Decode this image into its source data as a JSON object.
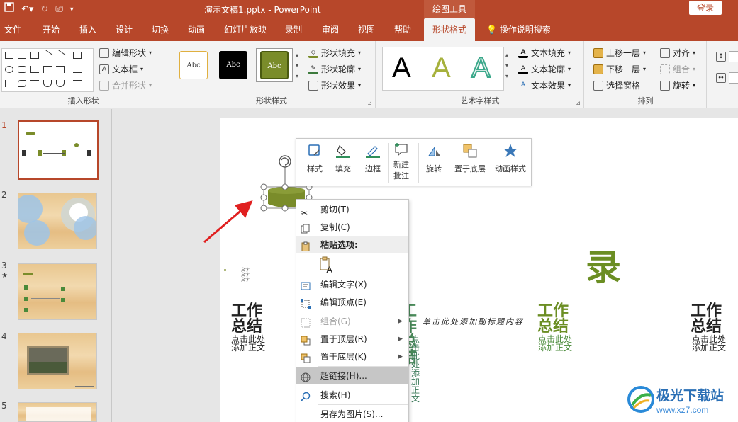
{
  "titlebar": {
    "doc_title": "演示文稿1.pptx  -  PowerPoint",
    "context_tools": "绘图工具",
    "login": "登录"
  },
  "tabs": [
    "文件",
    "开始",
    "插入",
    "设计",
    "切换",
    "动画",
    "幻灯片放映",
    "录制",
    "审阅",
    "视图",
    "帮助",
    "形状格式",
    "操作说明搜索"
  ],
  "ribbon": {
    "insert_shapes": {
      "label": "插入形状",
      "edit_shape": "编辑形状",
      "text_box": "文本框",
      "merge_shapes": "合并形状"
    },
    "shape_styles": {
      "label": "形状样式",
      "swatch_text": "Abc",
      "fill": "形状填充",
      "outline": "形状轮廓",
      "effects": "形状效果"
    },
    "wordart": {
      "label": "艺术字样式",
      "letter": "A",
      "text_fill": "文本填充",
      "text_outline": "文本轮廓",
      "text_effects": "文本效果"
    },
    "arrange": {
      "label": "排列",
      "bring_forward": "上移一层",
      "send_backward": "下移一层",
      "selection_pane": "选择窗格",
      "align": "对齐",
      "group": "组合",
      "rotate": "旋转"
    }
  },
  "thumbnails": [
    "1",
    "2",
    "3",
    "4",
    "5"
  ],
  "slide": {
    "title_block": "工作\n总结",
    "sub_line1": "点击此处",
    "sub_line2": "添加正文",
    "big_char": "录",
    "subtitle_line": "单击此处添加副标题内容"
  },
  "minibar": {
    "style": "样式",
    "fill": "填充",
    "outline": "边框",
    "new_comment_1": "新建",
    "new_comment_2": "批注",
    "rotate": "旋转",
    "send_back": "置于底层",
    "animation": "动画样式"
  },
  "context_menu": {
    "cut": "剪切(T)",
    "copy": "复制(C)",
    "paste_options": "粘贴选项:",
    "edit_text": "编辑文字(X)",
    "edit_points": "编辑顶点(E)",
    "group": "组合(G)",
    "bring_front": "置于顶层(R)",
    "send_back": "置于底层(K)",
    "hyperlink": "超链接(H)...",
    "search": "搜索(H)",
    "save_as_picture": "另存为图片(S)..."
  },
  "watermark": {
    "name": "极光下载站",
    "url": "www.xz7.com"
  },
  "colors": {
    "accent": "#b7472a",
    "shape_green": "#7a8c2a",
    "title_green": "#6b8e23"
  }
}
